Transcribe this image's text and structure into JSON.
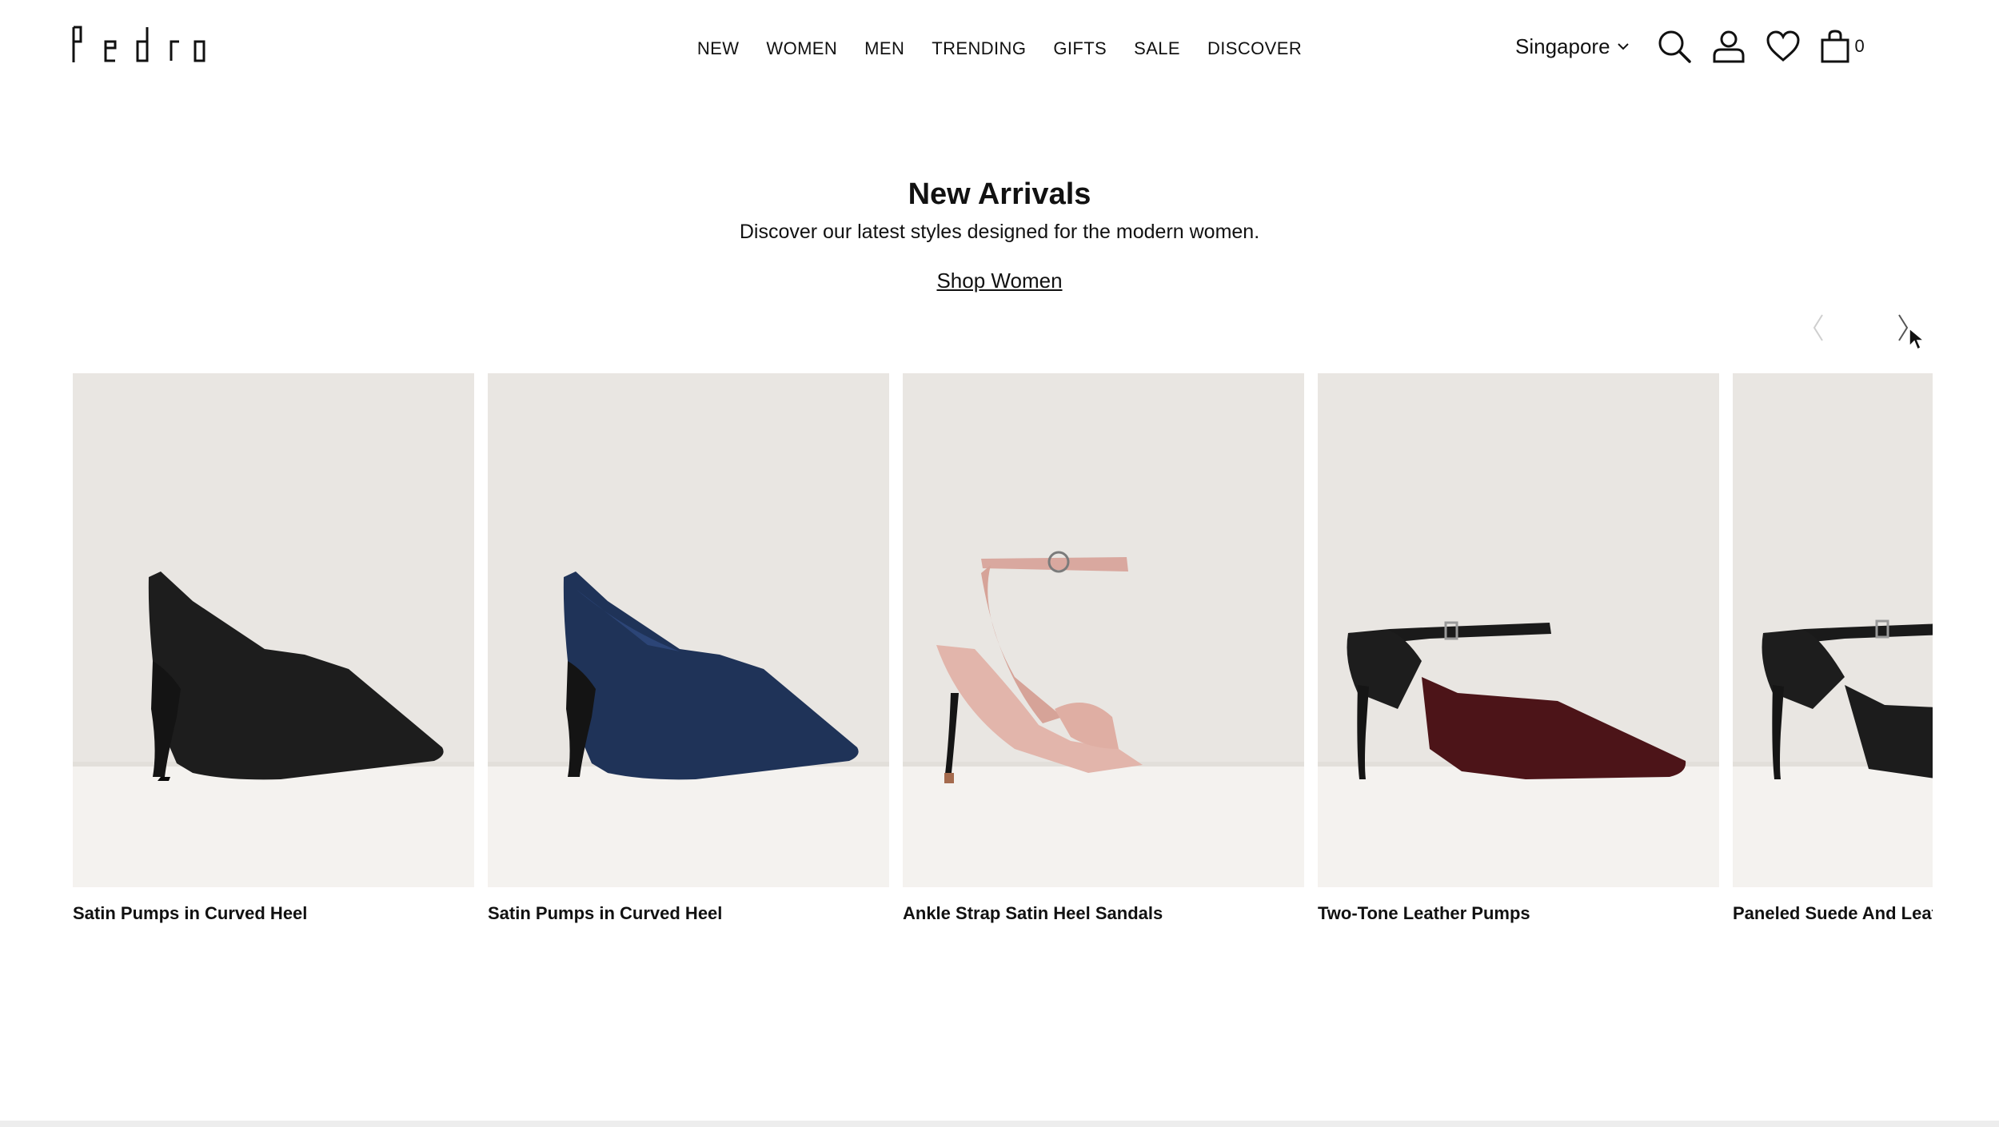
{
  "brand": {
    "logo_text": "Pedro"
  },
  "nav": {
    "items": [
      "NEW",
      "WOMEN",
      "MEN",
      "TRENDING",
      "GIFTS",
      "SALE",
      "DISCOVER"
    ]
  },
  "utility": {
    "country": "Singapore",
    "cart_count": "0"
  },
  "hero": {
    "title": "New Arrivals",
    "subtitle": "Discover our latest styles designed for the modern women.",
    "link": "Shop Women"
  },
  "products": [
    {
      "name": "Satin Pumps in Curved Heel",
      "image": "black-satin-pump"
    },
    {
      "name": "Satin Pumps in Curved Heel",
      "image": "navy-satin-pump"
    },
    {
      "name": "Ankle Strap Satin Heel Sandals",
      "image": "pink-ankle-strap-sandal"
    },
    {
      "name": "Two-Tone Leather Pumps",
      "image": "burgundy-two-tone-pump"
    },
    {
      "name": "Paneled Suede And Leat",
      "image": "black-paneled-pump"
    }
  ],
  "colors": {
    "text": "#111111",
    "image_bg": "#e9e6e2",
    "shelf": "#f4f2ef"
  }
}
